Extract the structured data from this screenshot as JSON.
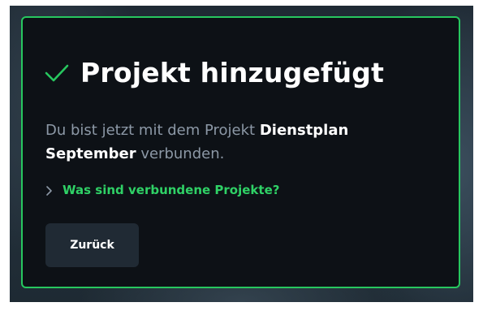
{
  "dialog": {
    "title": "Projekt hinzugefügt",
    "message": {
      "prefix": "Du bist jetzt mit dem Projekt ",
      "project_name": "Dienstplan September",
      "suffix": " verbunden."
    },
    "disclosure": {
      "label": "Was sind verbundene Projekte?",
      "icon": "chevron-right-icon"
    },
    "back_button_label": "Zurück",
    "title_icon": "check-icon"
  },
  "colors": {
    "accent_green": "#27c75f",
    "link_green": "#2fd166",
    "dialog_background": "#0d1116",
    "muted_text": "#8c98a6",
    "button_background": "#202a34",
    "title_text": "#ffffff"
  }
}
